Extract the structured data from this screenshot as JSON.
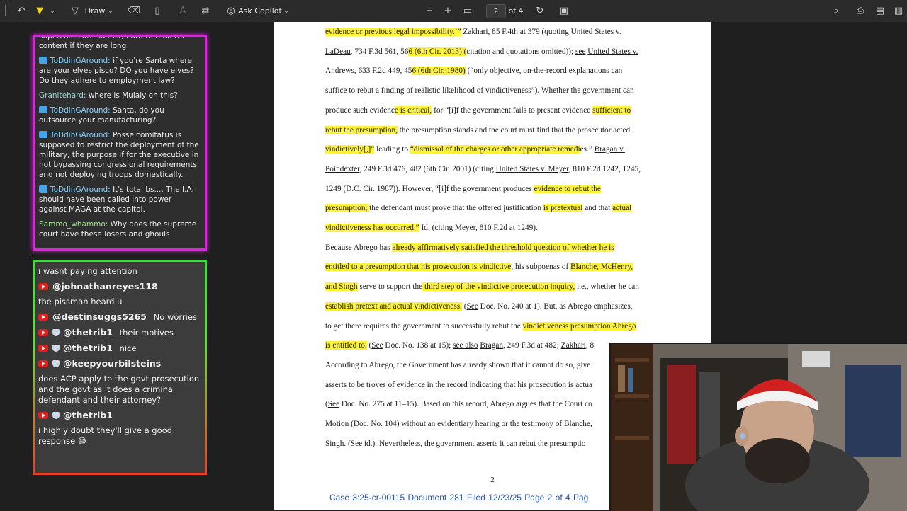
{
  "toolbar": {
    "draw_label": "Draw",
    "copilot_label": "Ask Copilot",
    "page_current": "2",
    "page_total": "of 4"
  },
  "chat_top": {
    "messages": [
      {
        "name": "",
        "text": "superchats are so fast, hard to read the content if they are long",
        "badge": false,
        "style": ""
      },
      {
        "name": "ToDdinGAround:",
        "text": "if you're Santa where are your elves pisco? DO you have elves? Do they adhere to employment law?",
        "badge": true,
        "style": ""
      },
      {
        "name": "Granitehard:",
        "text": "where is Mulaly on this?",
        "badge": false,
        "style": "alt1"
      },
      {
        "name": "ToDdinGAround:",
        "text": "Santa, do you outsource your manufacturing?",
        "badge": true,
        "style": ""
      },
      {
        "name": "ToDdinGAround:",
        "text": "Posse comitatus is supposed to restrict the deployment of the military, the purpose if for the executive in not bypassing congressional requirements and not deploying troops domestically.",
        "badge": true,
        "style": ""
      },
      {
        "name": "ToDdinGAround:",
        "text": "It's total bs.... The I.A. should have been called into power against MAGA at the capitol.",
        "badge": true,
        "style": ""
      },
      {
        "name": "Sammo_whammo:",
        "text": "Why does the supreme court have these losers and ghouls",
        "badge": false,
        "style": "alt2"
      }
    ]
  },
  "chat_bottom": {
    "lines": [
      {
        "type": "text",
        "text": "i wasnt paying attention"
      },
      {
        "type": "user",
        "user": "@johnathanreyes118",
        "cup": false,
        "inline": ""
      },
      {
        "type": "text",
        "text": "the pissman heard u"
      },
      {
        "type": "user",
        "user": "@destinsuggs5265",
        "cup": false,
        "inline": "No worries"
      },
      {
        "type": "user",
        "user": "@thetrib1",
        "cup": true,
        "inline": "their motives"
      },
      {
        "type": "user",
        "user": "@thetrib1",
        "cup": true,
        "inline": "nice"
      },
      {
        "type": "user",
        "user": "@keepyourbilsteins",
        "cup": true,
        "inline": ""
      },
      {
        "type": "text",
        "text": "does ACP apply to the govt prosecution and the govt as it does a criminal defendant and their attorney?"
      },
      {
        "type": "user",
        "user": "@thetrib1",
        "cup": true,
        "inline": ""
      },
      {
        "type": "text",
        "text": "i highly doubt they'll give a good response 😅"
      }
    ]
  },
  "document": {
    "lines": [
      [
        [
          "evidence or previous legal impossibility.’”",
          "hl"
        ],
        [
          "  Zakhari, 85 F.4th at 379 (quoting ",
          ""
        ],
        [
          "United States v.",
          "u"
        ]
      ],
      [
        [
          "LaDeau",
          "u"
        ],
        [
          ", 734 F.3d 561, 56",
          ""
        ],
        [
          "6 (6th Cir. 2013) (",
          "hl"
        ],
        [
          "citation and quotations omitted)); ",
          ""
        ],
        [
          "see",
          "u"
        ],
        [
          " ",
          ""
        ],
        [
          "United States v.",
          "u"
        ]
      ],
      [
        [
          "Andrews",
          "u"
        ],
        [
          ", 633 F.2d 449, 45",
          ""
        ],
        [
          "6 (6th Cir. 1980)",
          "hl"
        ],
        [
          " (“only objective, on-the-record explanations can",
          ""
        ]
      ],
      [
        [
          "suffice to rebut a finding of realistic likelihood of vindictiveness”).  Whether the government can",
          ""
        ]
      ],
      [
        [
          "produce such evidenc",
          ""
        ],
        [
          "e is critical,",
          "hl"
        ],
        [
          " for “[i]f the government fails to present evidence ",
          ""
        ],
        [
          "sufficient to",
          "hl"
        ]
      ],
      [
        [
          "rebut the presumption,",
          "hl"
        ],
        [
          " the presumption stands and the court must find that the prosecutor acted",
          ""
        ]
      ],
      [
        [
          "vindictively[,]”",
          "hl"
        ],
        [
          " leading to ",
          ""
        ],
        [
          "“dismissal of the charges or other appropriate remedi",
          "hl"
        ],
        [
          "es.”  ",
          ""
        ],
        [
          "Bragan v.",
          "u"
        ]
      ],
      [
        [
          "Poindexter",
          "u"
        ],
        [
          ", 249 F.3d 476, 482 (6th Cir. 2001) (citing ",
          ""
        ],
        [
          "United States v. Meyer",
          "u"
        ],
        [
          ", 810 F.2d 1242, 1245,",
          ""
        ]
      ],
      [
        [
          "1249 (D.C. Cir. 1987)).   However, “[i]f the government produces ",
          ""
        ],
        [
          "evidence to rebut the",
          "hl"
        ]
      ],
      [
        [
          "presumption, ",
          "hl"
        ],
        [
          "the defendant must prove that the offered justification ",
          ""
        ],
        [
          "is pretextual",
          "hl"
        ],
        [
          " and that ",
          ""
        ],
        [
          "actual",
          "hl"
        ]
      ],
      [
        [
          "vindictiveness has occurred.”",
          "hl"
        ],
        [
          "  ",
          ""
        ],
        [
          "Id.",
          "u"
        ],
        [
          " (citing ",
          ""
        ],
        [
          "Meyer",
          "u"
        ],
        [
          ", 810 F.2d at 1249).",
          ""
        ]
      ],
      [
        [
          "        Because Abrego has ",
          ""
        ],
        [
          "already affirmatively satisfied the threshold question of whether he is",
          "hl"
        ]
      ],
      [
        [
          "entitled to a presumption that his prosecution is vindictive",
          "hl"
        ],
        [
          ", his subpoenas of ",
          ""
        ],
        [
          "Blanche, McHenry,",
          "hl"
        ]
      ],
      [
        [
          "and Singh",
          "hl"
        ],
        [
          " serve to support the",
          ""
        ],
        [
          " third step of the vindictive prosecution inquiry,",
          "hl"
        ],
        [
          " i.e.",
          ""
        ],
        [
          ", whether he can",
          ""
        ]
      ],
      [
        [
          "establish pretext and actual vindictiveness.",
          "hl"
        ],
        [
          "  (",
          ""
        ],
        [
          "See",
          "u"
        ],
        [
          " Doc. No. 240 at 1).  But, as Abrego emphasizes,",
          ""
        ]
      ],
      [
        [
          "to get there requires the government to successfully rebut the ",
          ""
        ],
        [
          "vindictiveness presumption Abrego",
          "hl"
        ]
      ],
      [
        [
          "is entitled to.",
          "hl"
        ],
        [
          "  (",
          ""
        ],
        [
          "See",
          "u"
        ],
        [
          " Doc. No. 138 at 15); ",
          ""
        ],
        [
          "see also",
          "u"
        ],
        [
          " ",
          ""
        ],
        [
          "Bragan",
          "u"
        ],
        [
          ", 249 F.3d at 482; ",
          ""
        ],
        [
          "Zakhari",
          "u"
        ],
        [
          ", 8",
          ""
        ]
      ],
      [
        [
          "According to Abrego, the Government has already shown that it cannot do so, give",
          ""
        ]
      ],
      [
        [
          "asserts to be troves of evidence in the record indicating that his prosecution is actua",
          ""
        ]
      ],
      [
        [
          "(",
          ""
        ],
        [
          "See",
          "u"
        ],
        [
          " Doc. No. 275 at 11–15).  Based on this record, Abrego argues that the Court co",
          ""
        ]
      ],
      [
        [
          "Motion (Doc. No. 104) without an evidentiary hearing or the testimony of Blanche,",
          ""
        ]
      ],
      [
        [
          "Singh.  (",
          ""
        ],
        [
          "See id.",
          "u"
        ],
        [
          ").  Nevertheless, the government asserts it can rebut the presumptio",
          ""
        ]
      ]
    ],
    "page_number": "2",
    "footer": "Case 3:25-cr-00115    Document 281    Filed 12/23/25    Page 2 of 4 Pag"
  }
}
